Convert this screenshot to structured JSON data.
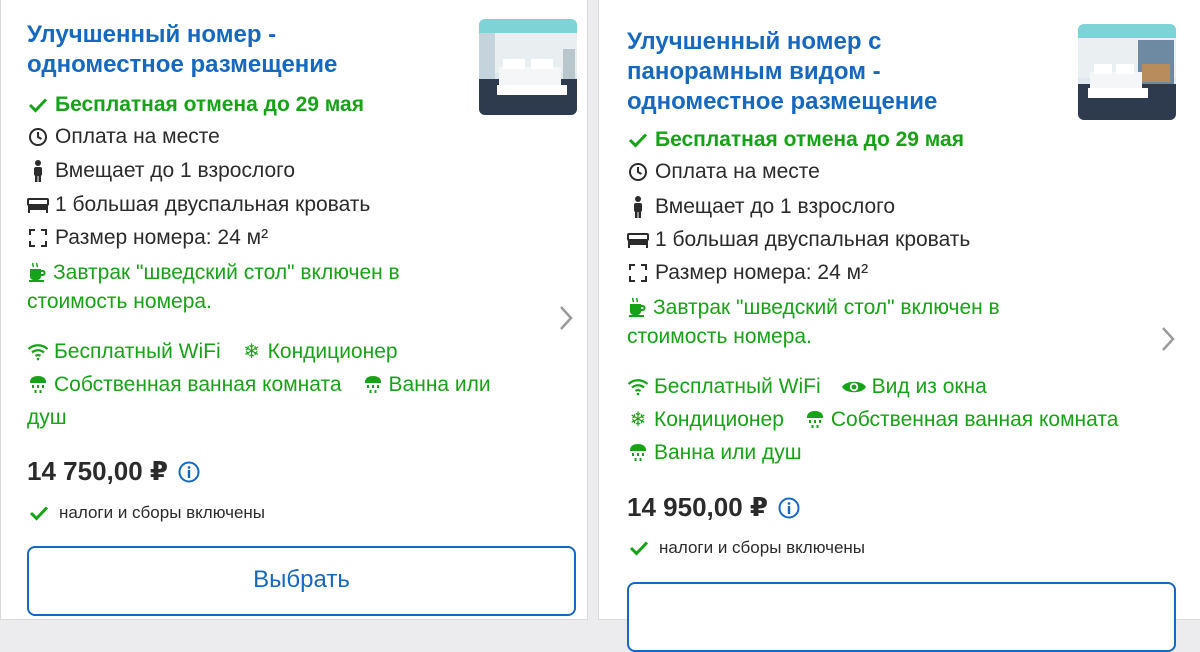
{
  "colors": {
    "title": "#1668c1",
    "green": "#17a317",
    "text": "#2b2b2b",
    "button": "#1668c1"
  },
  "rooms": [
    {
      "title_lines": [
        "Улучшенный номер -",
        "одноместное размещение"
      ],
      "free_cancel": "Бесплатная отмена до 29 мая",
      "payment": "Оплата на месте",
      "capacity": "Вмещает до 1 взрослого",
      "bed": "1 большая двуспальная кровать",
      "size": "Размер номера: 24 м²",
      "breakfast_lines": [
        "Завтрак \"шведский стол\" включен в",
        "стоимость номера."
      ],
      "amenities": {
        "wifi": "Бесплатный WiFi",
        "ac": "Кондиционер",
        "bathroom": "Собственная ванная комната",
        "bath_line1": "Ванна или",
        "bath_line2": "душ"
      },
      "price": "14 750,00 ₽",
      "taxes": "налоги и сборы включены",
      "select": "Выбрать"
    },
    {
      "title_lines": [
        "Улучшенный номер с",
        "панорамным видом -",
        "одноместное размещение"
      ],
      "free_cancel": "Бесплатная отмена до 29 мая",
      "payment": "Оплата на месте",
      "capacity": "Вмещает до 1 взрослого",
      "bed": "1 большая двуспальная кровать",
      "size": "Размер номера: 24 м²",
      "breakfast_lines": [
        "Завтрак \"шведский стол\" включен в",
        "стоимость номера."
      ],
      "amenities": {
        "wifi": "Бесплатный WiFi",
        "view": "Вид из окна",
        "ac": "Кондиционер",
        "bathroom": "Собственная ванная комната",
        "bath": "Ванна или душ"
      },
      "price": "14 950,00 ₽",
      "taxes": "налоги и сборы включены"
    }
  ],
  "icons": [
    "checkmark-icon",
    "clock-icon",
    "person-icon",
    "bed-icon",
    "expand-icon",
    "coffee-cup-icon",
    "wifi-icon",
    "snowflake-icon",
    "shower-icon",
    "eye-icon",
    "info-icon",
    "chevron-right-icon"
  ]
}
